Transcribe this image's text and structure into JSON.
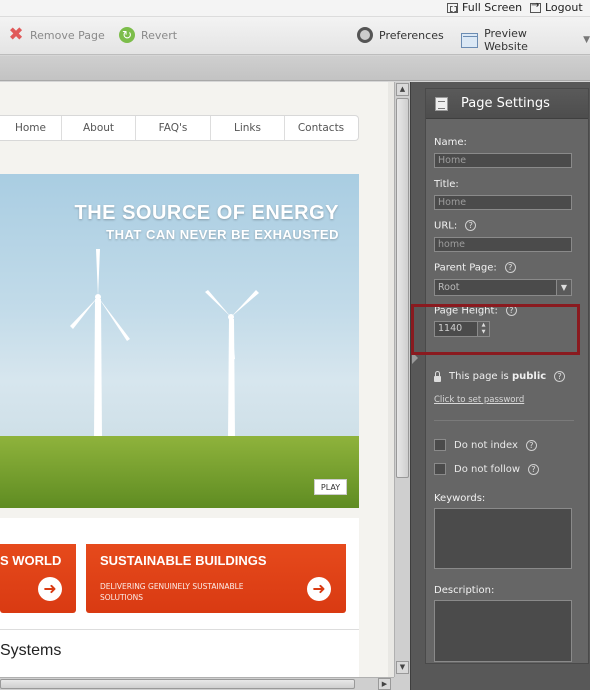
{
  "topbar": {
    "fullscreen_label": "Full Screen",
    "logout_label": "Logout"
  },
  "toolbar": {
    "remove_page_label": "Remove Page",
    "revert_label": "Revert",
    "preferences_label": "Preferences",
    "preview_label": "Preview Website"
  },
  "site": {
    "nav": [
      "Home",
      "About",
      "FAQ's",
      "Links",
      "Contacts"
    ],
    "hero_title": "THE SOURCE OF ENERGY",
    "hero_subtitle": "THAT CAN NEVER BE EXHAUSTED",
    "play_label": "PLAY",
    "promo_left_title": "S WORLD",
    "promo_right_title": "SUSTAINABLE BUILDINGS",
    "promo_right_sub": "DELIVERING GENUINELY SUSTAINABLE SOLUTIONS",
    "section_heading": "Systems"
  },
  "panel": {
    "title": "Page Settings",
    "name_label": "Name:",
    "name_value": "Home",
    "title_label": "Title:",
    "title_value": "Home",
    "url_label": "URL:",
    "url_value": "home",
    "parent_label": "Parent Page:",
    "parent_value": "Root",
    "height_label": "Page Height:",
    "height_value": "1140",
    "public_prefix": "This page is",
    "public_value": "public",
    "password_link": "Click to set password",
    "noindex_label": "Do not index",
    "nofollow_label": "Do not follow",
    "keywords_label": "Keywords:",
    "description_label": "Description:",
    "help_glyph": "?"
  },
  "colors": {
    "accent_orange": "#e64a1c",
    "panel_bg": "#585858",
    "highlight_border": "#8a1a1f"
  }
}
